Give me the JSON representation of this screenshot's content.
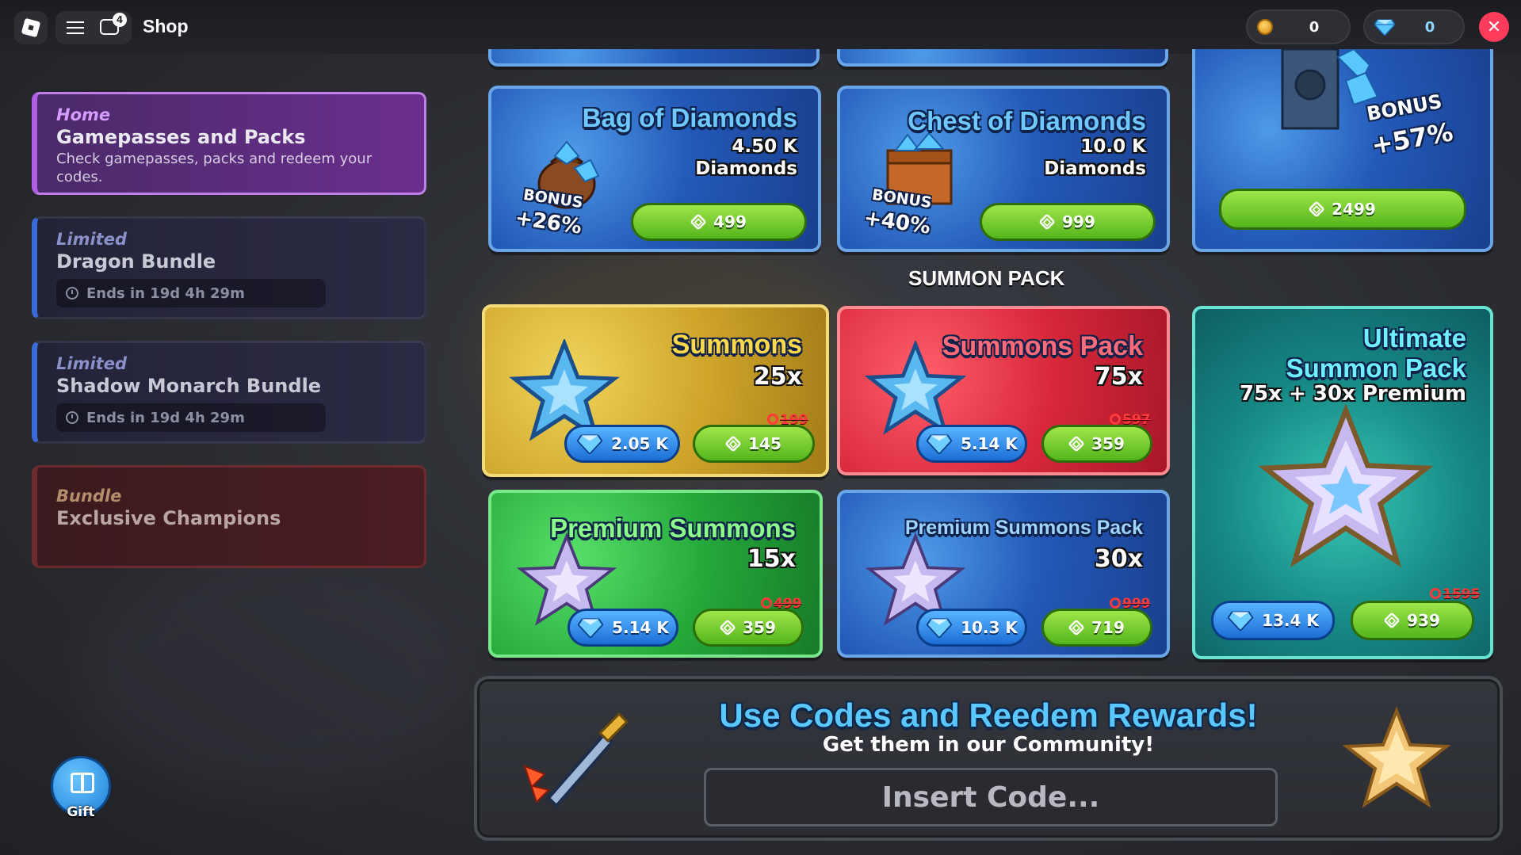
{
  "topbar": {
    "title": "Shop",
    "chat_badge": "4",
    "coins": "0",
    "diamonds": "0"
  },
  "sidebar": {
    "items": [
      {
        "tag": "Home",
        "name": "Gamepasses and Packs",
        "desc": "Check gamepasses, packs and redeem your codes."
      },
      {
        "tag": "Limited",
        "name": "Dragon Bundle",
        "timer": "Ends in 19d 4h 29m"
      },
      {
        "tag": "Limited",
        "name": "Shadow Monarch Bundle",
        "timer": "Ends in 19d 4h 29m"
      },
      {
        "tag": "Bundle",
        "name": "Exclusive Champions"
      }
    ],
    "gift_label": "Gift"
  },
  "diamond_packs": {
    "bag": {
      "title": "Bag of Diamonds",
      "amount": "4.50 K",
      "unit": "Diamonds",
      "bonus_word": "BONUS",
      "bonus_pct": "+26%",
      "price": "499"
    },
    "chest": {
      "title": "Chest of Diamonds",
      "amount": "10.0 K",
      "unit": "Diamonds",
      "bonus_word": "BONUS",
      "bonus_pct": "+40%",
      "price": "999"
    },
    "vault": {
      "bonus_word": "BONUS",
      "bonus_pct": "+57%",
      "price": "2499"
    }
  },
  "summon_section_title": "SUMMON PACK",
  "summon_packs": {
    "summons": {
      "title": "Summons",
      "qty": "25x",
      "gem_price": "2.05 K",
      "price": "145",
      "old_price": "199"
    },
    "summons_pack": {
      "title": "Summons Pack",
      "qty": "75x",
      "gem_price": "5.14 K",
      "price": "359",
      "old_price": "597"
    },
    "ultimate": {
      "title_line1": "Ultimate",
      "title_line2": "Summon Pack",
      "qty": "75x + 30x Premium",
      "gem_price": "13.4 K",
      "price": "939",
      "old_price": "1595"
    },
    "premium": {
      "title": "Premium Summons",
      "qty": "15x",
      "gem_price": "5.14 K",
      "price": "359",
      "old_price": "499"
    },
    "premium_pack": {
      "title": "Premium Summons Pack",
      "qty": "30x",
      "gem_price": "10.3 K",
      "price": "719",
      "old_price": "999"
    }
  },
  "codes": {
    "title": "Use Codes and Reedem Rewards!",
    "subtitle": "Get them in our Community!",
    "placeholder": "Insert Code..."
  },
  "colors": {
    "accent_purple": "#b05de6",
    "diamond_blue": "#5ac8ff",
    "buy_green": "#54b51c",
    "close_red": "#ff3b5c",
    "old_price_red": "#ff3a3a"
  },
  "icons": [
    "roblox-logo-icon",
    "menu-icon",
    "chat-icon",
    "coin-icon",
    "diamond-icon",
    "close-icon",
    "clock-icon",
    "gift-icon",
    "robux-icon",
    "star-icon",
    "sword-icon"
  ]
}
